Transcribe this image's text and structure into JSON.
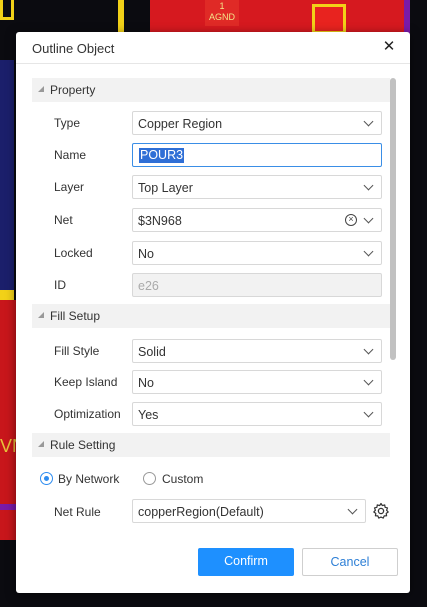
{
  "background": {
    "pad_label_number": "1",
    "pad_label_net": "AGND",
    "left_text": "VN"
  },
  "dialog": {
    "title": "Outline Object",
    "close_icon": "close-icon"
  },
  "sections": {
    "property": "Property",
    "fill_setup": "Fill Setup",
    "rule_setting": "Rule Setting"
  },
  "property": {
    "type_label": "Type",
    "type_value": "Copper Region",
    "name_label": "Name",
    "name_value": "POUR3",
    "layer_label": "Layer",
    "layer_value": "Top Layer",
    "net_label": "Net",
    "net_value": "$3N968",
    "locked_label": "Locked",
    "locked_value": "No",
    "id_label": "ID",
    "id_value": "e26"
  },
  "fill_setup": {
    "fill_style_label": "Fill Style",
    "fill_style_value": "Solid",
    "keep_island_label": "Keep Island",
    "keep_island_value": "No",
    "optimization_label": "Optimization",
    "optimization_value": "Yes"
  },
  "rule_setting": {
    "by_network_label": "By Network",
    "by_network_selected": true,
    "custom_label": "Custom",
    "net_rule_label": "Net Rule",
    "net_rule_value": "copperRegion(Default)"
  },
  "buttons": {
    "confirm": "Confirm",
    "cancel": "Cancel"
  },
  "colors": {
    "accent": "#1e90ff",
    "copper": "#d6191f",
    "silkscreen": "#f2d118",
    "board_outline": "#7a1aa8"
  }
}
